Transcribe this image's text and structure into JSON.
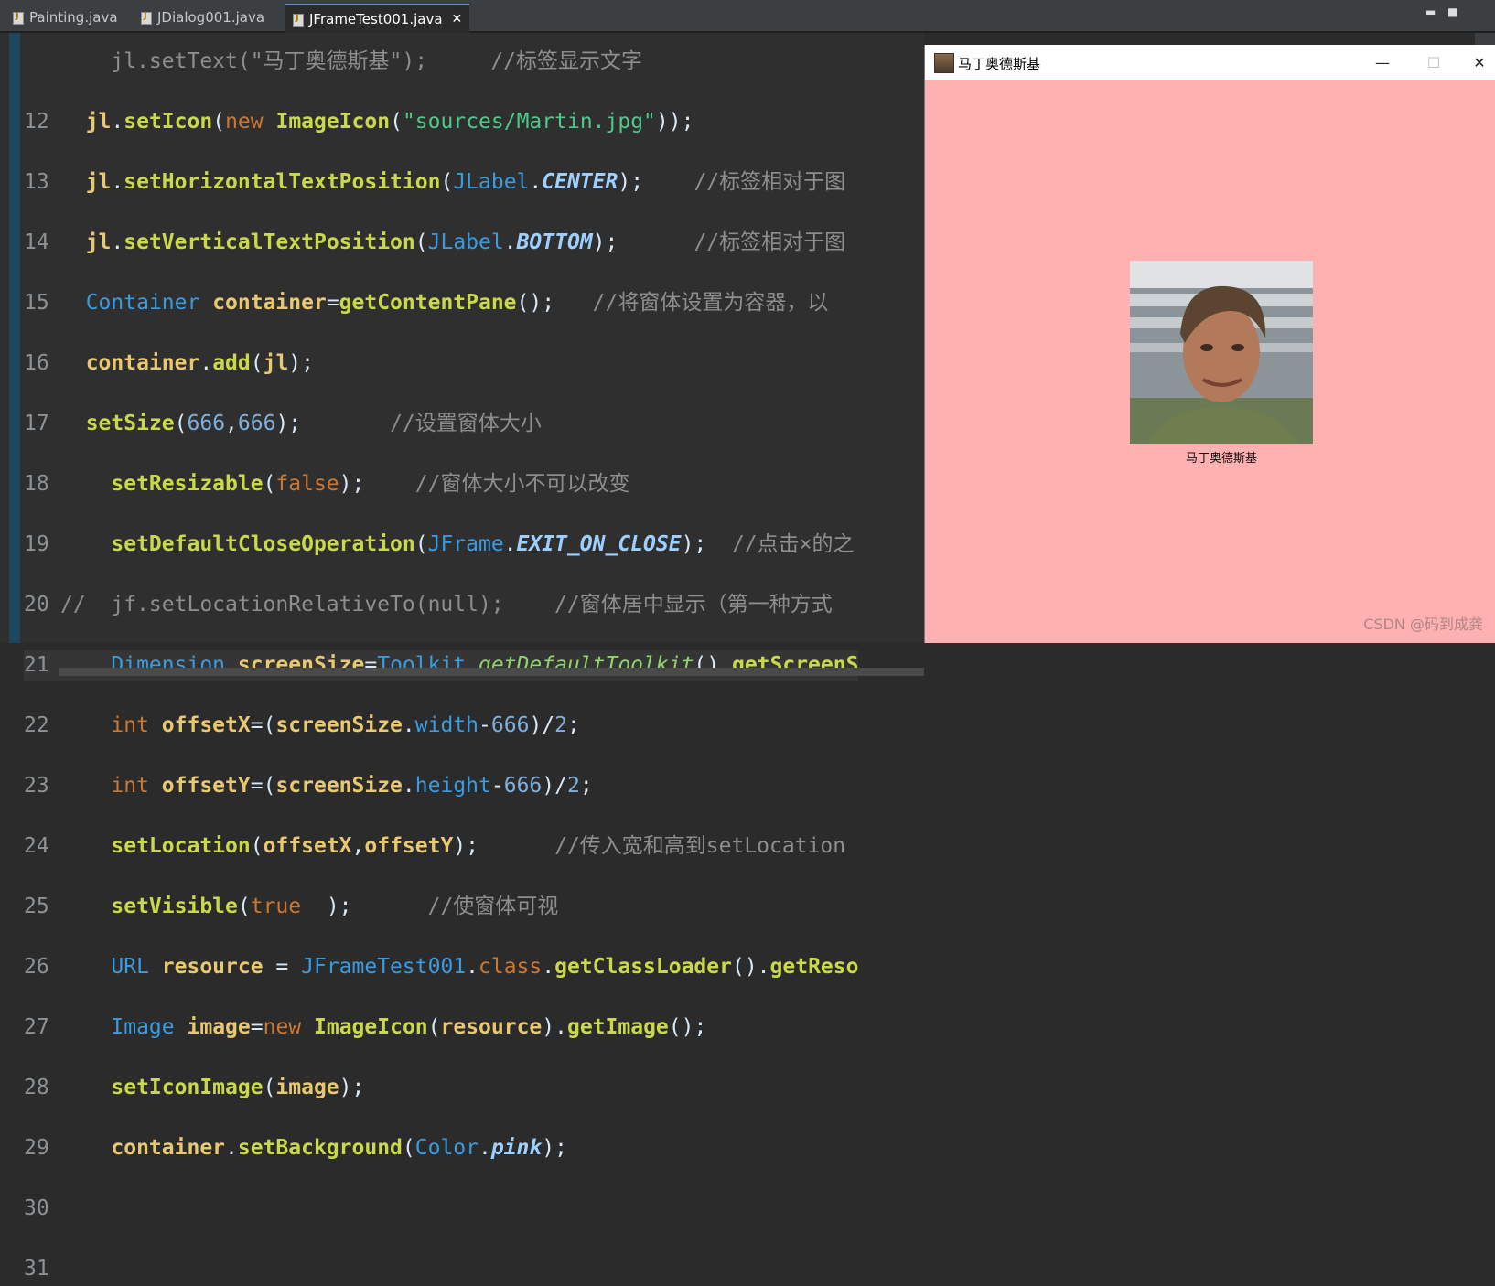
{
  "tabs": [
    {
      "label": "Painting.java"
    },
    {
      "label": "JDialog001.java"
    },
    {
      "label": "JFrameTest001.java"
    }
  ],
  "editor": {
    "line_numbers": [
      "12",
      "13",
      "14",
      "15",
      "16",
      "17",
      "18",
      "19",
      "20",
      "21",
      "22",
      "23",
      "24",
      "25",
      "26",
      "27",
      "28",
      "29",
      "30",
      "31"
    ],
    "top_fragment": "    jl.setText(\"马丁奥德斯基\");     //标签显示文字"
  },
  "frame": {
    "title": "马丁奥德斯基",
    "label_text": "马丁奥德斯基",
    "background": "#ffb0b0",
    "minimize": "—",
    "maximize": "☐",
    "close": "✕"
  },
  "watermark": "CSDN @码到成龚",
  "colors": {
    "keyword": "#cc7832",
    "type": "#3a9be0",
    "method": "#c9d94a",
    "string": "#4ec98a",
    "comment": "#8e8e8e"
  }
}
